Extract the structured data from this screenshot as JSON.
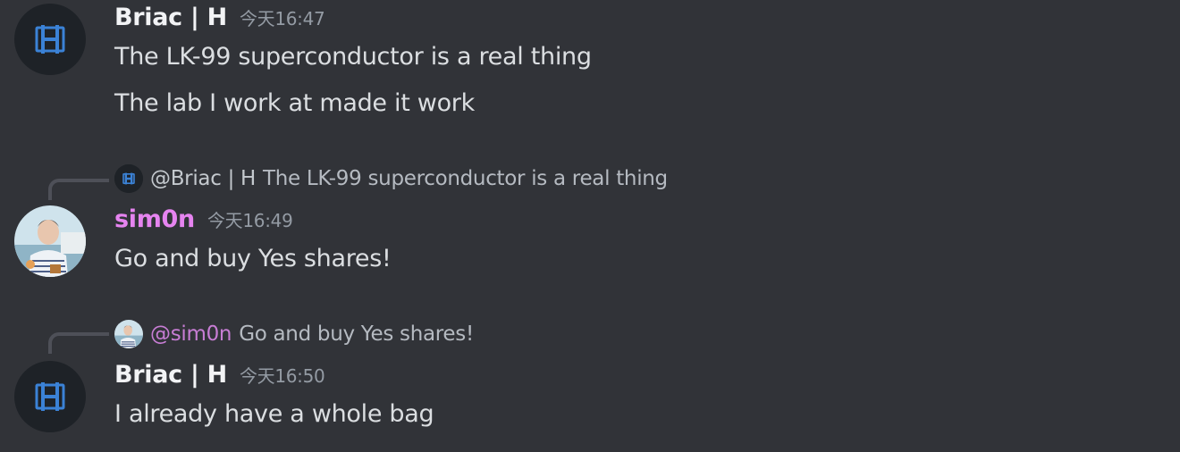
{
  "messages": [
    {
      "author": "Briac | H",
      "timestamp": "今天16:47",
      "avatar_icon": "letter-h-logo-icon",
      "lines": [
        "The LK-99 superconductor is a real thing",
        "The lab I work at made it work"
      ]
    },
    {
      "author": "sim0n",
      "timestamp": "今天16:49",
      "avatar_icon": "user-photo-avatar",
      "name_color": "#e684f0",
      "reply": {
        "mention": "@Briac | H",
        "text": "The LK-99 superconductor is a real thing"
      },
      "lines": [
        "Go and buy Yes shares!"
      ]
    },
    {
      "author": "Briac | H",
      "timestamp": "今天16:50",
      "avatar_icon": "letter-h-logo-icon",
      "reply": {
        "mention": "@sim0n",
        "text": "Go and buy Yes shares!"
      },
      "lines": [
        "I already have a whole bag"
      ]
    }
  ],
  "colors": {
    "background": "#313338",
    "text": "#dbdee1",
    "muted": "#949ba4",
    "accent_pink": "#e684f0",
    "logo_blue": "#3b82d6"
  }
}
